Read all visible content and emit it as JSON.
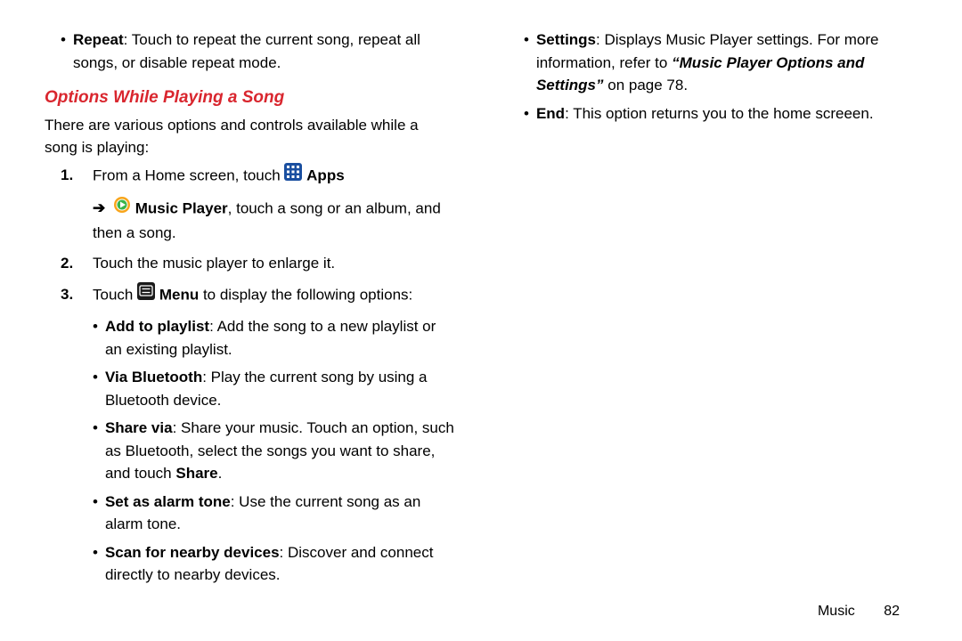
{
  "left": {
    "topBullet": {
      "label": "Repeat",
      "text": ": Touch to repeat the current song, repeat all songs, or disable repeat mode."
    },
    "heading": "Options While Playing a Song",
    "intro": "There are various options and controls available while a song is playing:",
    "step1": {
      "prefix": "From a Home screen, touch ",
      "apps": " Apps",
      "line2a": " Music Player",
      "line2b": ", touch a song or an album, and then a song."
    },
    "step2": "Touch the music player to enlarge it.",
    "step3": {
      "prefix": "Touch ",
      "menu": " Menu",
      "suffix": " to display the following options:"
    },
    "subBullets": {
      "addLabel": "Add to playlist",
      "addText": ": Add the song to a new playlist or an existing playlist.",
      "btLabel": "Via Bluetooth",
      "btText": ": Play the current song by using a Bluetooth device.",
      "shareLabel": "Share via",
      "shareText1": ": Share your music. Touch an option, such as Bluetooth, select the songs you want to share, and touch ",
      "shareText2": "Share",
      "shareText3": ".",
      "alarmLabel": "Set as alarm tone",
      "alarmText": ": Use the current song as an alarm tone.",
      "scanLabel": "Scan for nearby devices",
      "scanText": ": Discover and connect directly to nearby devices."
    }
  },
  "right": {
    "settings": {
      "label": "Settings",
      "text1": ": Displays Music Player settings. For more information, refer to ",
      "ref": "“Music Player Options and Settings”",
      "text2": " on page 78."
    },
    "end": {
      "label": "End",
      "text": ": This option returns you to the home screeen."
    }
  },
  "footer": {
    "section": "Music",
    "page": "82"
  },
  "numbers": {
    "n1": "1.",
    "n2": "2.",
    "n3": "3."
  }
}
